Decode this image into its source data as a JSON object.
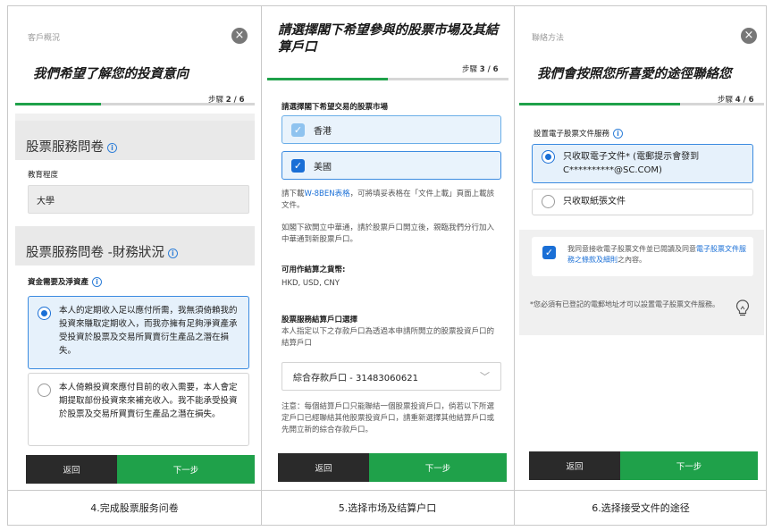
{
  "panel1": {
    "crumb": "客戶概況",
    "title": "我們希望了解您的投資意向",
    "step_prefix": "步驟",
    "step_value": "2 / 6",
    "progress": 0.33,
    "section1_title": "股票服務問卷",
    "edu_label": "教育程度",
    "edu_value": "大學",
    "section2_title": "股票服務問卷 -財務狀況",
    "asset_label": "資金需要及淨資產",
    "option1": "本人的定期收入足以應付所需，我無須倚賴我的投資來賺取定期收入，而我亦擁有足夠淨資產承受投資於股票及交易所買賣衍生產品之潛在損失。",
    "option2": "本人倚賴投資來應付目前的收入需要，本人會定期提取部份投資來來補充收入。我不能承受投資於股票及交易所買賣衍生產品之潛在損失。",
    "back": "返回",
    "next": "下一步"
  },
  "panel2": {
    "title": "請選擇閣下希望參與的股票市場及其結算戶口",
    "step_prefix": "步驟",
    "step_value": "3 / 6",
    "progress": 0.5,
    "market_label": "請選擇閣下希望交易的股票市場",
    "market_hk": "香港",
    "market_us": "美國",
    "wbe_prefix": "請下載",
    "wbe_link": "W-8BEN表格",
    "wbe_suffix": "，可將填妥表格在「文件上載」頁面上載該文件。",
    "para2": "如閣下欲開立中華通，請於股票戶口開立後，親臨我們分行加入中華通到新股票戶口。",
    "currency_label": "可用作結算之貨幣:",
    "currency_value": "HKD, USD, CNY",
    "settle_label": "股票服務結算戶口選擇",
    "settle_desc": "本人指定以下之存款戶口為透過本申請所開立的股票投資戶口的結算戶口",
    "settle_value": "綜合存款戶口 - 31483060621",
    "note": "注意：每個結算戶口只能聯結一個股票投資戶口，倘若以下所選定戶口已經聯結其他股票投資戶口，請重新選擇其他結算戶口或先開立新的綜合存款戶口。",
    "back": "返回",
    "next": "下一步"
  },
  "panel3": {
    "crumb": "聯絡方法",
    "title": "我們會按照您所喜愛的途徑聯絡您",
    "step_prefix": "步驟",
    "step_value": "4 / 6",
    "progress": 0.67,
    "setting_label": "設置電子股票文件服務",
    "opt_electronic": "只收取電子文件* (電郵提示會發到C**********@SC.COM)",
    "opt_paper": "只收取紙張文件",
    "agree_prefix": "我同意接收電子股票文件並已閱讀及同意",
    "agree_link": "電子股票文件服務之條款及細則",
    "agree_suffix": "之內容。",
    "footnote": "*您必須有已登記的電郵地址才可以設置電子股票文件服務。",
    "back": "返回",
    "next": "下一步"
  },
  "captions": {
    "c1": "4.完成股票服务问卷",
    "c2": "5.选择市场及结算户口",
    "c3": "6.选择接受文件的途径"
  },
  "colors": {
    "accent_green": "#1fa14a",
    "accent_blue": "#1a6fd6",
    "dark_button": "#2a2a2a"
  },
  "icons": [
    "close-icon",
    "info-icon",
    "checkbox-checked-icon",
    "radio-selected-icon",
    "chevron-down-icon",
    "lightbulb-icon"
  ]
}
